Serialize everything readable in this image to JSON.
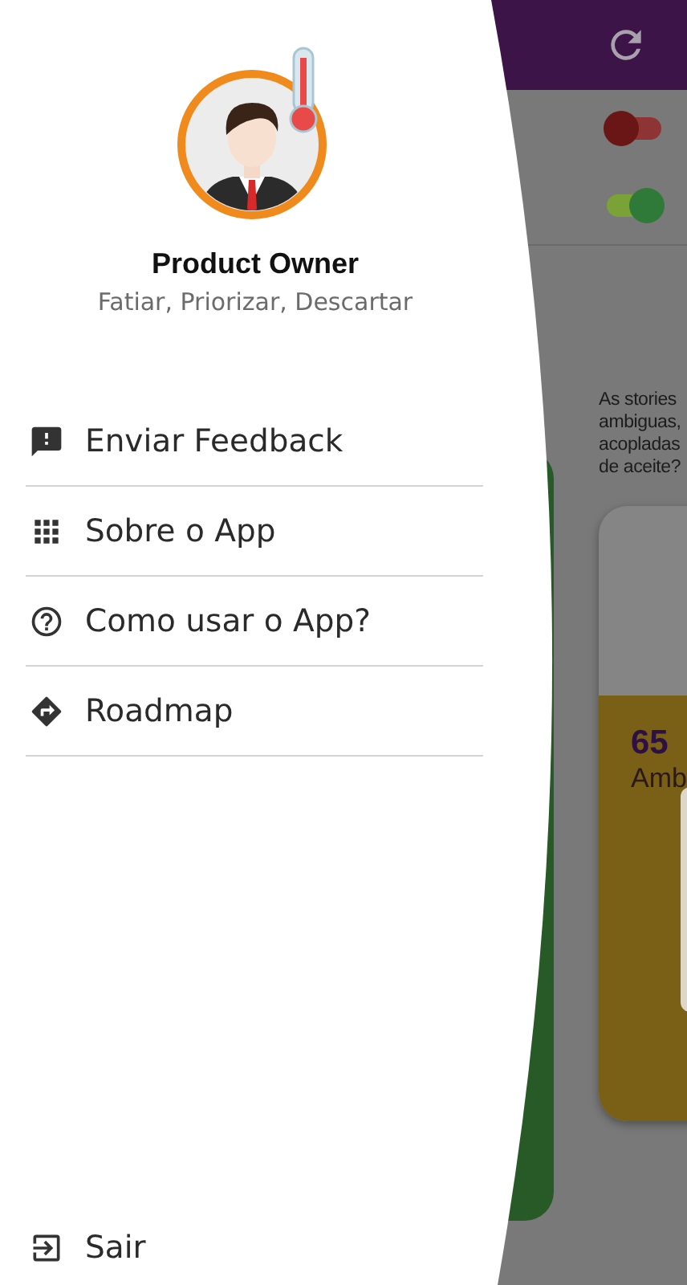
{
  "background": {
    "toggles": [
      {
        "on": false
      },
      {
        "on": true
      }
    ],
    "question_lines": [
      "As stories",
      "ambiguas,",
      "acopladas",
      "de aceite?"
    ],
    "score_card": {
      "value": "65",
      "label": "Amb"
    }
  },
  "drawer": {
    "profile": {
      "title": "Product Owner",
      "subtitle": "Fatiar, Priorizar, Descartar"
    },
    "menu": [
      {
        "kind": "feedback",
        "label": "Enviar Feedback"
      },
      {
        "kind": "apps",
        "label": "Sobre o App"
      },
      {
        "kind": "help",
        "label": "Como usar o App?"
      },
      {
        "kind": "directions",
        "label": "Roadmap"
      }
    ],
    "logout": {
      "label": "Sair"
    }
  }
}
